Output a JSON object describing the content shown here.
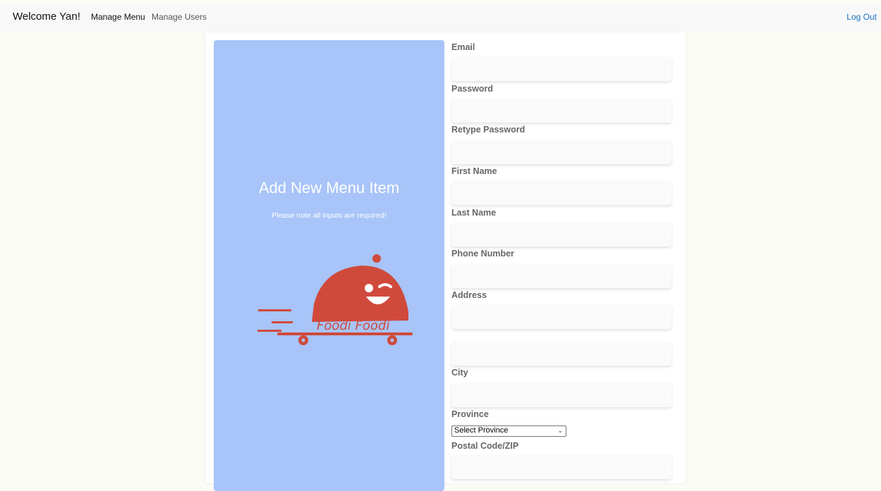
{
  "nav": {
    "brand": "Welcome Yan!",
    "links": [
      "Manage Menu",
      "Manage Users"
    ],
    "logout": "Log Out"
  },
  "panel": {
    "title": "Add New Menu Item",
    "note": "Please note all inputs are required!",
    "logo_text": "Foodi Foodi",
    "colors": {
      "panel_bg": "#a8c4f8",
      "logo_red": "#d04a3c"
    }
  },
  "form": {
    "email_label": "Email",
    "email_value": "",
    "password_label": "Password",
    "password_value": "",
    "retype_label": "Retype Password",
    "retype_value": "",
    "first_name_label": "First Name",
    "first_name_value": "",
    "last_name_label": "Last Name",
    "last_name_value": "",
    "phone_label": "Phone Number",
    "phone_value": "",
    "address_label": "Address",
    "address_value": "",
    "address2_value": "",
    "city_label": "City",
    "city_value": "",
    "province_label": "Province",
    "province_selected": "Select Province",
    "postal_label": "Postal Code/ZIP",
    "postal_value": ""
  }
}
